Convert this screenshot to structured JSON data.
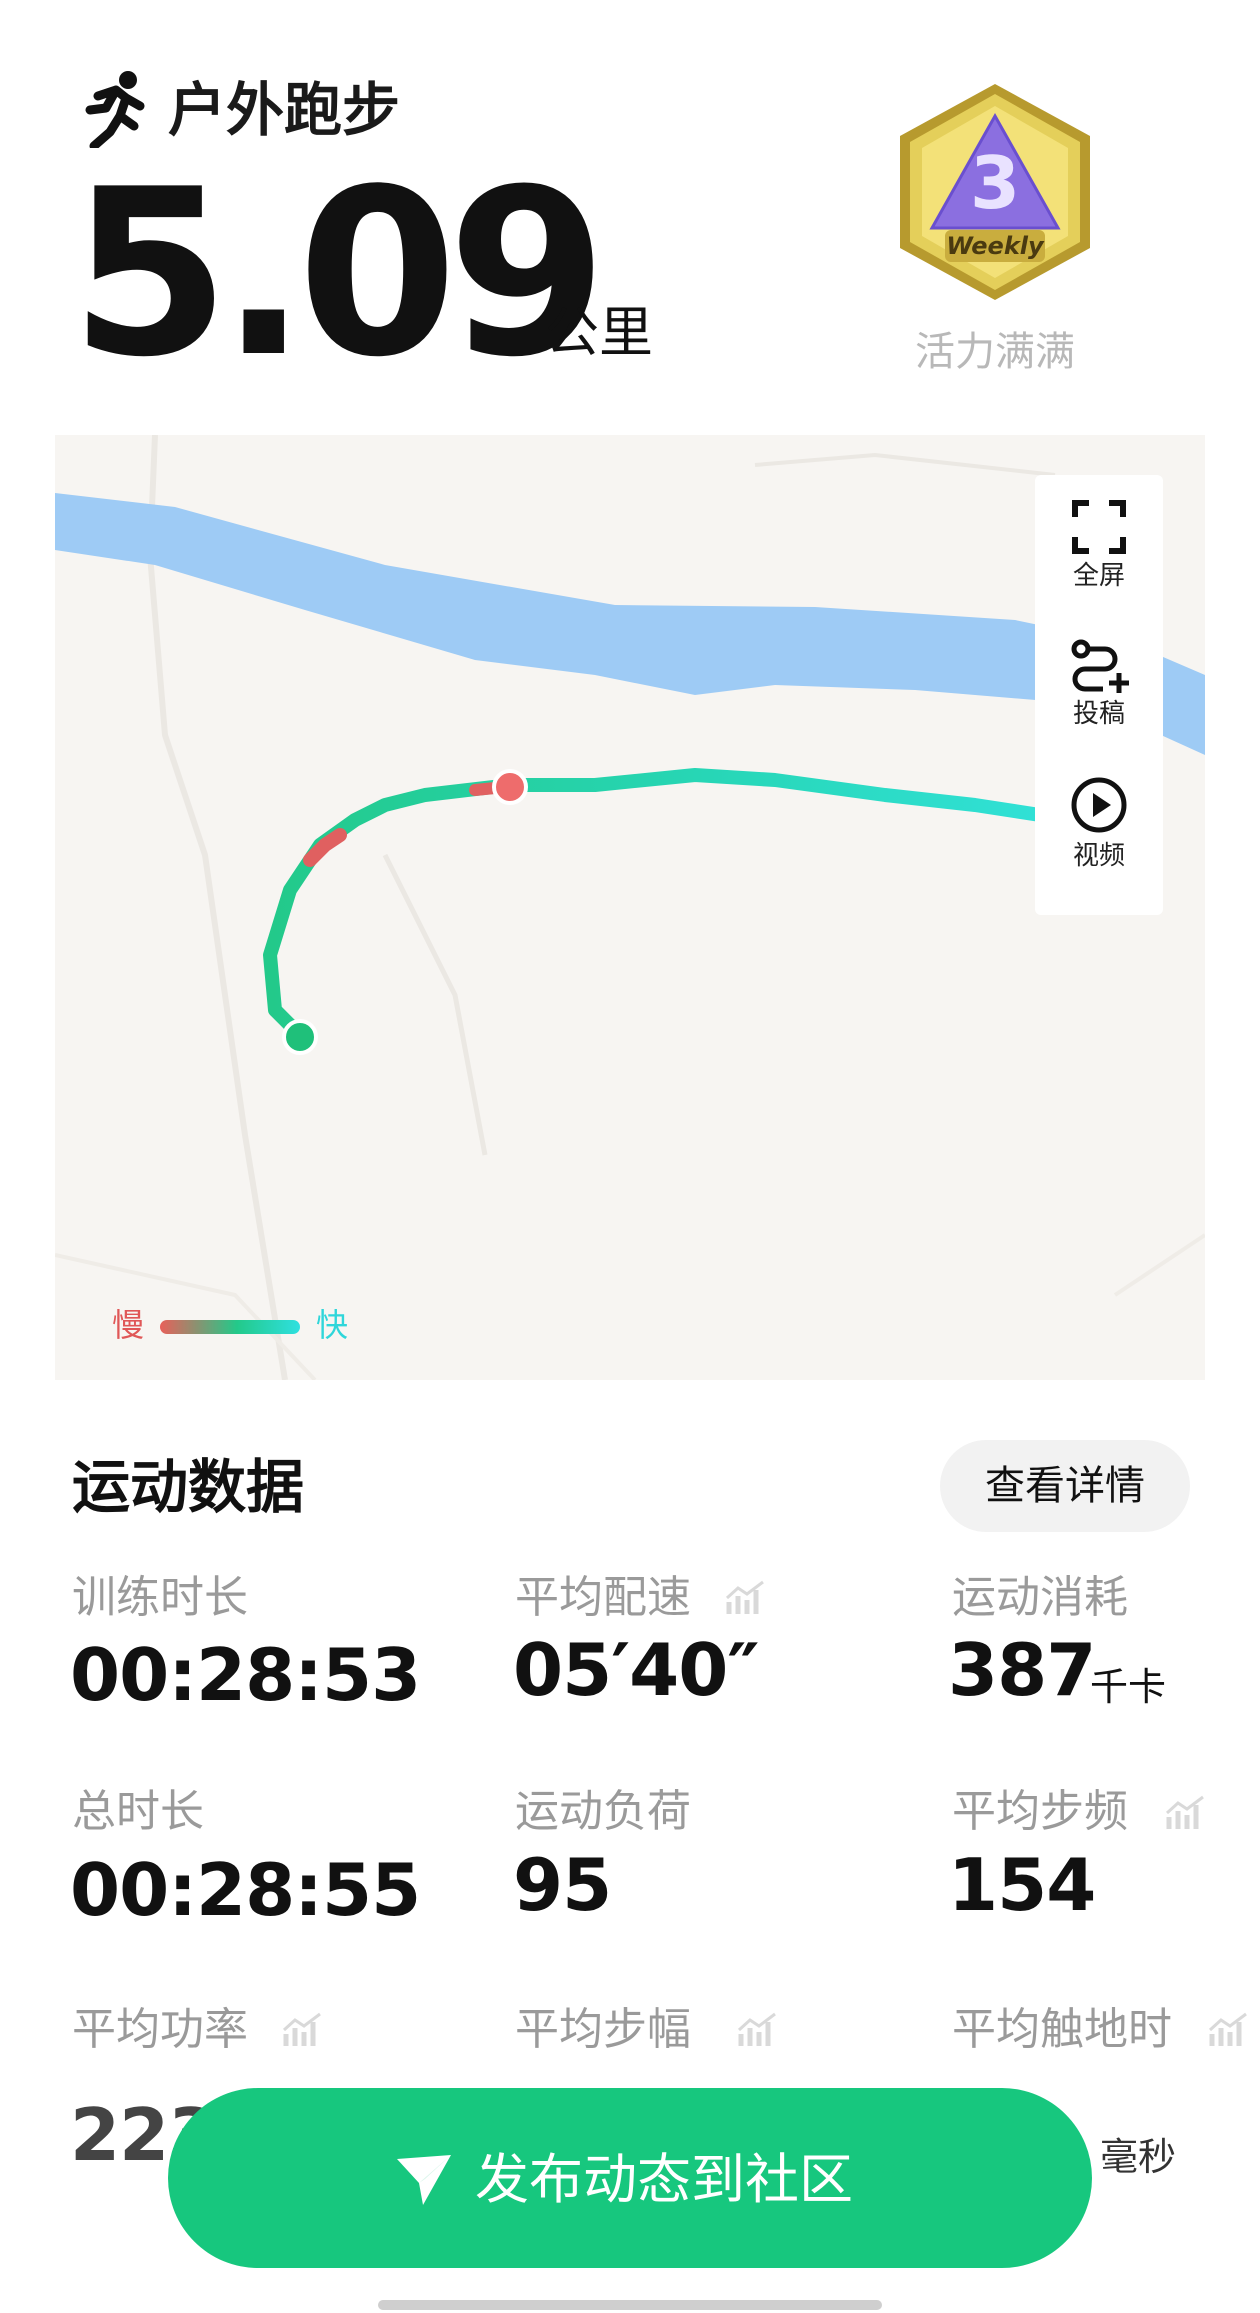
{
  "header": {
    "activity_type": "户外跑步",
    "distance": "5.09",
    "distance_unit": "公里",
    "badge_text": "Weekly",
    "badge_number": "3",
    "badge_label": "活力满满"
  },
  "map": {
    "controls": [
      {
        "label": "全屏",
        "icon": "fullscreen-icon"
      },
      {
        "label": "投稿",
        "icon": "route-add-icon"
      },
      {
        "label": "视频",
        "icon": "play-icon"
      }
    ],
    "legend": {
      "slow": "慢",
      "fast": "快"
    },
    "colors": {
      "slow": "#e8605a",
      "mid": "#23c98a",
      "fast": "#2fe0e0",
      "river": "#9ecbf5"
    }
  },
  "stats": {
    "section_title": "运动数据",
    "details_button": "查看详情",
    "metrics": [
      {
        "label": "训练时长",
        "value": "00:28:53",
        "unit": ""
      },
      {
        "label": "平均配速",
        "value": "05′40″",
        "unit": "",
        "trend_icon": true
      },
      {
        "label": "运动消耗",
        "value": "387",
        "unit": "千卡"
      },
      {
        "label": "总时长",
        "value": "00:28:55",
        "unit": ""
      },
      {
        "label": "运动负荷",
        "value": "95",
        "unit": ""
      },
      {
        "label": "平均步频",
        "value": "154",
        "unit": "",
        "trend_icon": true
      },
      {
        "label": "平均功率",
        "value": "223",
        "unit": "",
        "trend_icon": true
      },
      {
        "label": "平均步幅",
        "value": "",
        "unit": "",
        "trend_icon": true
      },
      {
        "label": "平均触地时",
        "value": "",
        "unit": "毫秒",
        "trend_icon": true
      }
    ]
  },
  "footer": {
    "publish_label": "发布动态到社区",
    "accent_color": "#17c77e"
  }
}
